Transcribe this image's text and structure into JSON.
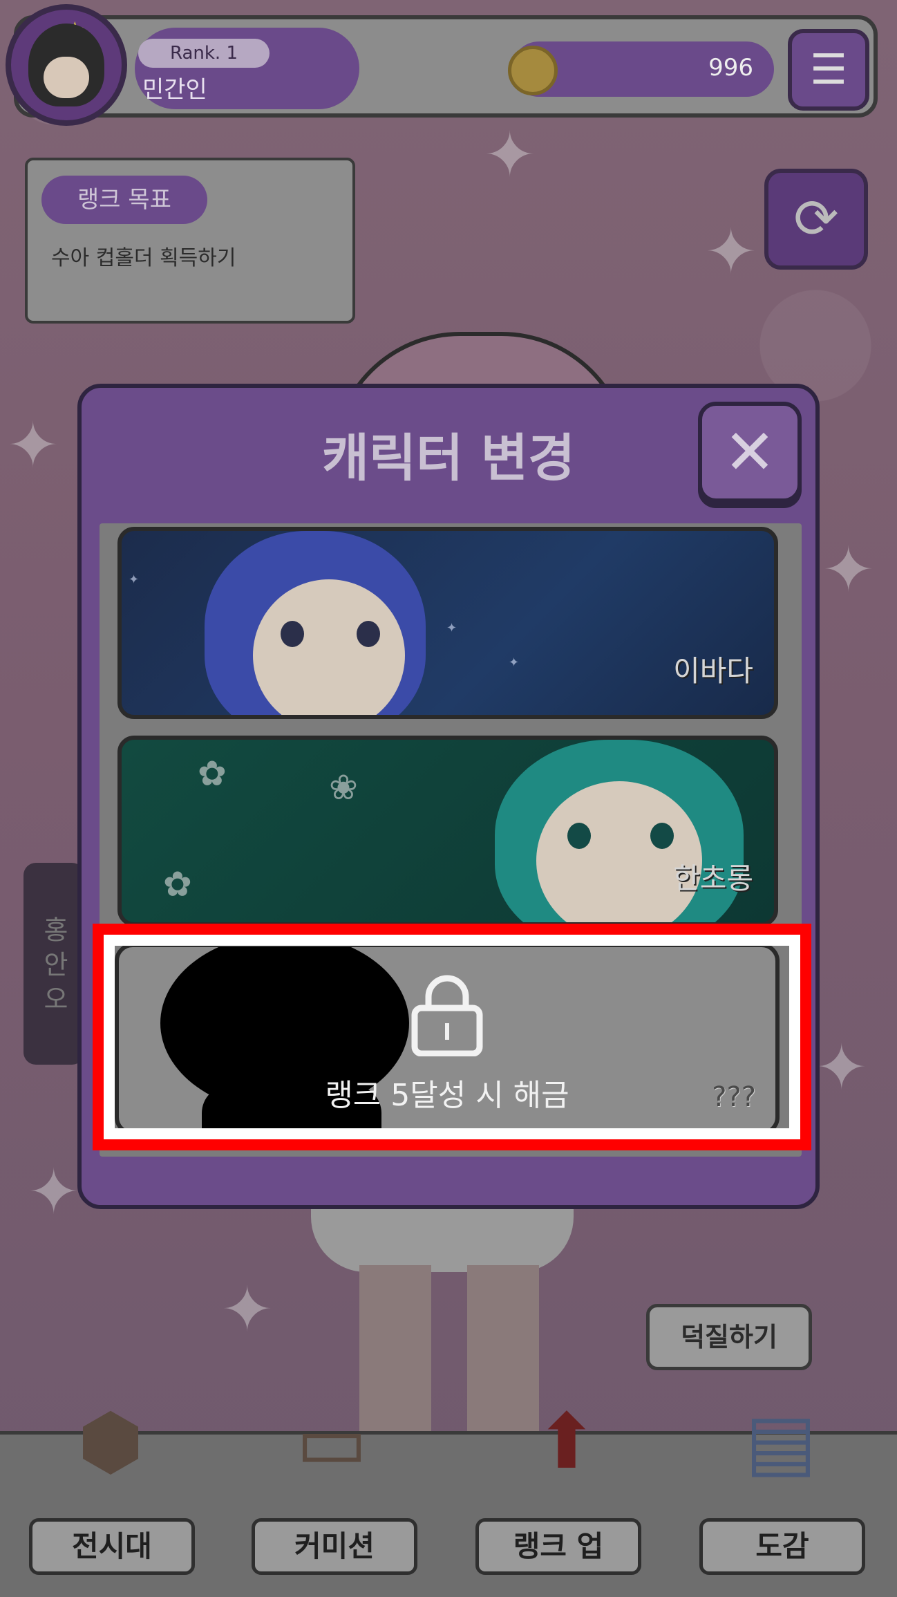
{
  "header": {
    "rank_label": "Rank. 1",
    "username": "민간인",
    "coins": "996"
  },
  "rank_goal": {
    "title": "랭크 목표",
    "description": "수아 컵홀더 획득하기"
  },
  "side_tab": {
    "label": "홍 안 오"
  },
  "modal": {
    "title": "캐릭터 변경",
    "characters": [
      {
        "name": "이바다",
        "locked": false
      },
      {
        "name": "한초롱",
        "locked": false
      },
      {
        "name": "???",
        "locked": true,
        "unlock_text": "랭크 5달성 시 해금"
      }
    ]
  },
  "actions": {
    "duck_label": "덕질하기"
  },
  "bottom_nav": {
    "items": [
      {
        "label": "전시대"
      },
      {
        "label": "커미션"
      },
      {
        "label": "랭크 업"
      },
      {
        "label": "도감"
      }
    ]
  },
  "icons": {
    "menu": "list-icon",
    "refresh": "refresh-icon",
    "close": "close-icon",
    "lock": "lock-icon",
    "coin": "coin-icon"
  },
  "colors": {
    "primary_purple": "#6b4c8a",
    "highlight_red": "#ff0000"
  }
}
